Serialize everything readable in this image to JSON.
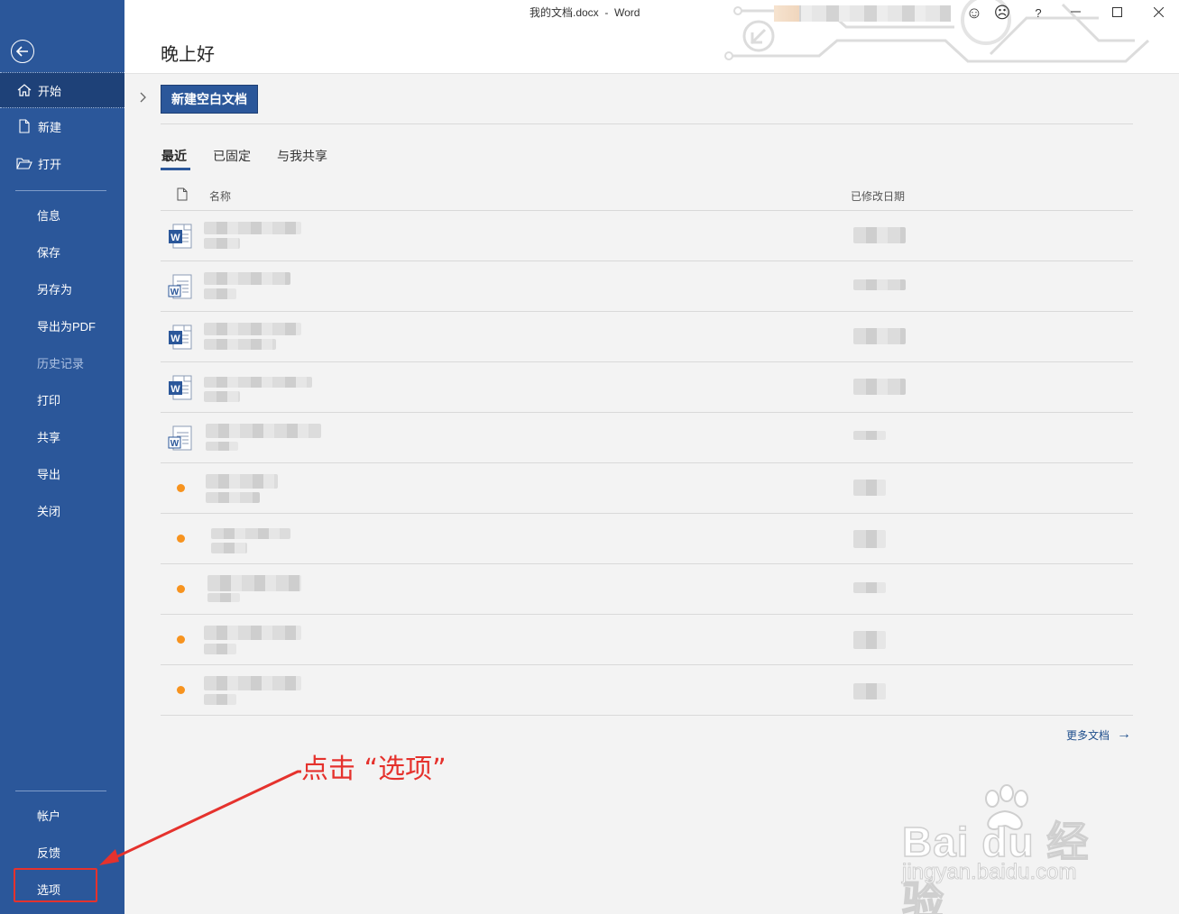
{
  "window": {
    "title": "我的文档.docx  -  Word",
    "help": "?",
    "minimize": "—",
    "maximize": "☐",
    "close": "✕",
    "smile": "☺",
    "frown": "☹"
  },
  "header": {
    "greeting": "晚上好"
  },
  "sidebar": {
    "back": "←",
    "top_items": [
      {
        "label": "开始",
        "icon": "home-icon",
        "active": true
      },
      {
        "label": "新建",
        "icon": "new-doc-icon"
      },
      {
        "label": "打开",
        "icon": "folder-open-icon"
      }
    ],
    "middle_items": [
      {
        "label": "信息"
      },
      {
        "label": "保存"
      },
      {
        "label": "另存为"
      },
      {
        "label": "导出为PDF"
      },
      {
        "label": "历史记录",
        "disabled": true
      },
      {
        "label": "打印"
      },
      {
        "label": "共享"
      },
      {
        "label": "导出"
      },
      {
        "label": "关闭"
      }
    ],
    "bottom_items": [
      {
        "label": "帐户"
      },
      {
        "label": "反馈"
      },
      {
        "label": "选项"
      }
    ]
  },
  "main": {
    "new_blank": "新建空白文档",
    "tabs": [
      "最近",
      "已固定",
      "与我共享"
    ],
    "active_tab": "最近",
    "columns": {
      "name": "名称",
      "modified": "已修改日期"
    },
    "rows": [
      {
        "icon": "word-docx-icon",
        "name": "",
        "date": ""
      },
      {
        "icon": "word-doc-icon",
        "name": "",
        "date": ""
      },
      {
        "icon": "word-docx-icon",
        "name": "",
        "date": ""
      },
      {
        "icon": "word-docx-icon",
        "name": "",
        "date": ""
      },
      {
        "icon": "word-doc-icon",
        "name": "",
        "date": ""
      },
      {
        "icon": "orange-dot-icon",
        "name": "",
        "date": ""
      },
      {
        "icon": "orange-dot-icon",
        "name": "",
        "date": ""
      },
      {
        "icon": "orange-dot-icon",
        "name": "",
        "date": ""
      },
      {
        "icon": "orange-dot-icon",
        "name": "",
        "date": ""
      },
      {
        "icon": "orange-dot-icon",
        "name": "",
        "date": ""
      }
    ],
    "more_docs": "更多文档",
    "more_arrow": "→"
  },
  "annotation": {
    "text": "点击 “选项”"
  },
  "watermark": {
    "text": "Bai  du 经验",
    "sub": "jingyan.baidu.com"
  },
  "colors": {
    "accent": "#2b579a",
    "annotation": "#e5322d",
    "recent_dot": "#f7931e"
  }
}
